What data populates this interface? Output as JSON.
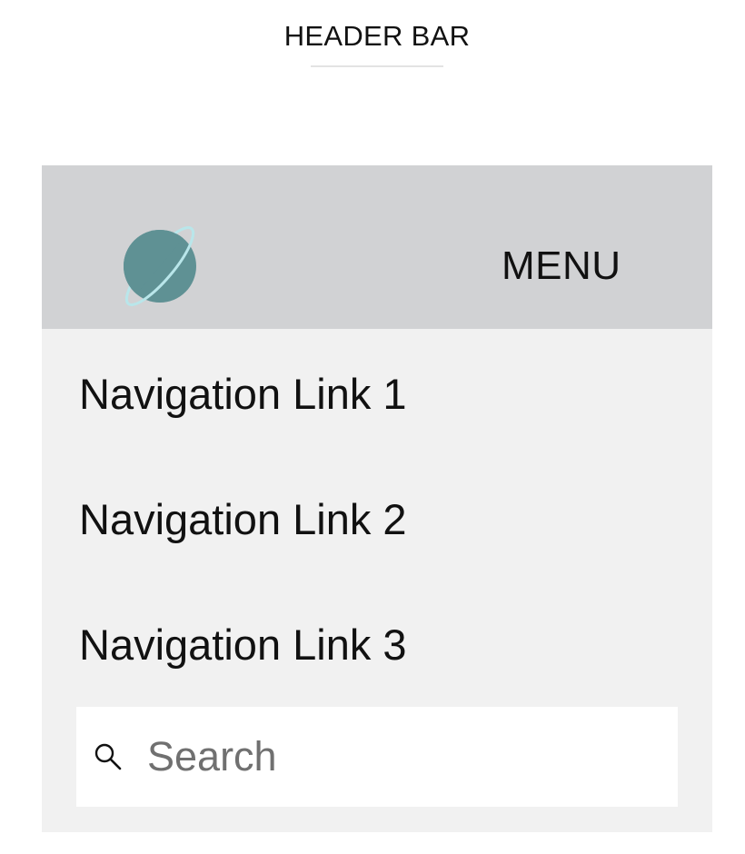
{
  "section_heading": "HEADER BAR",
  "nav": {
    "logo_icon": "planet-icon",
    "menu_label": "MENU",
    "links": [
      {
        "label": "Navigation Link 1"
      },
      {
        "label": "Navigation Link 2"
      },
      {
        "label": "Navigation Link 3"
      }
    ],
    "search": {
      "icon": "search-icon",
      "placeholder": "Search",
      "value": ""
    }
  },
  "colors": {
    "page_background": "#ffffff",
    "panel_background": "#f1f1f1",
    "nav_header_background": "#d1d2d4",
    "planet_fill": "#5f9194",
    "planet_ring": "#b9e6ea",
    "text": "#111111",
    "placeholder_text": "#707070"
  }
}
